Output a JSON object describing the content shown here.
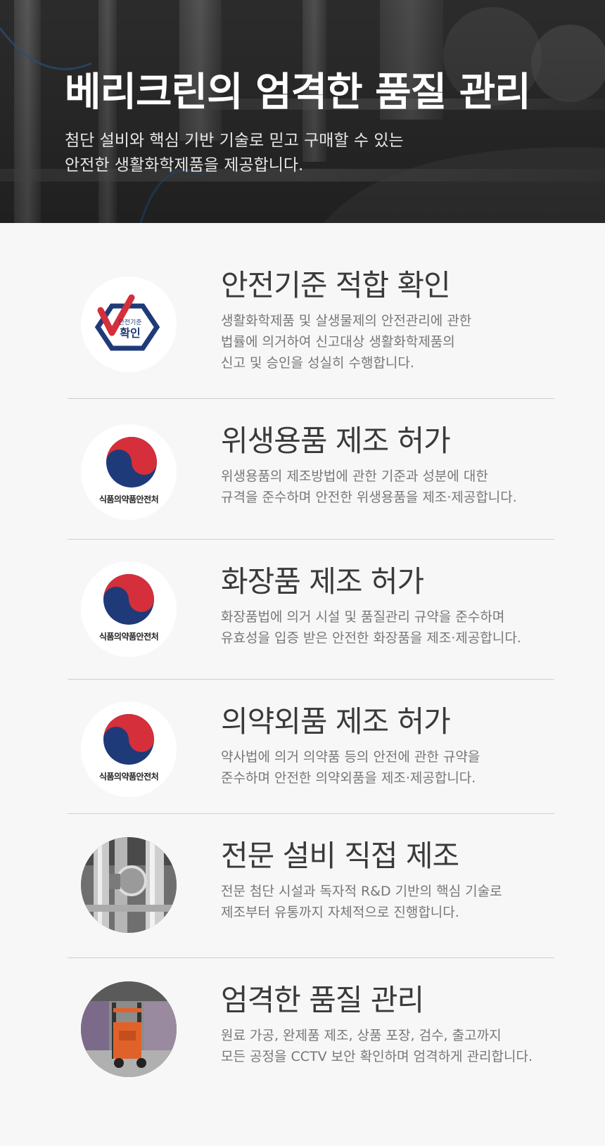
{
  "hero": {
    "title": "베리크린의 엄격한 품질 관리",
    "subtitle_line1": "첨단 설비와 핵심 기반 기술로 믿고 구매할 수 있는",
    "subtitle_line2": "안전한 생활화학제품을 제공합니다."
  },
  "items": [
    {
      "title": "안전기준 적합 확인",
      "desc": [
        "생활화학제품 및 살생물제의 안전관리에 관한",
        "법률에 의거하여 신고대상 생활화학제품의",
        "신고 및 승인을 성실히 수행합니다."
      ],
      "logo_text_small": "안전기준",
      "logo_text_big": "확인"
    },
    {
      "title": "위생용품 제조 허가",
      "desc": [
        "위생용품의 제조방법에 관한 기준과 성분에 대한",
        "규격을 준수하며 안전한 위생용품을 제조·제공합니다."
      ],
      "logo_label": "식품의약품안전처"
    },
    {
      "title": "화장품 제조 허가",
      "desc": [
        "화장품법에 의거 시설 및 품질관리 규약을 준수하며",
        "유효성을 입증 받은 안전한 화장품을 제조·제공합니다."
      ],
      "logo_label": "식품의약품안전처"
    },
    {
      "title": "의약외품 제조 허가",
      "desc": [
        "약사법에 의거 의약품 등의 안전에 관한 규약을",
        "준수하며 안전한 의약외품을 제조·제공합니다."
      ],
      "logo_label": "식품의약품안전처"
    },
    {
      "title": "전문 설비 직접 제조",
      "desc": [
        "전문 첨단 시설과 독자적 R&D 기반의 핵심 기술로",
        "제조부터 유통까지 자체적으로 진행합니다."
      ],
      "image": "stainless-equipment-photo"
    },
    {
      "title": "엄격한 품질 관리",
      "desc": [
        "원료 가공, 완제품 제조, 상품 포장, 검수, 출고까지",
        "모든 공정을 CCTV 보안 확인하며 엄격하게 관리합니다."
      ],
      "image": "forklift-warehouse-photo"
    }
  ],
  "colors": {
    "navy": "#1f3a78",
    "red": "#d42f3a",
    "divider": "#cfcfcf",
    "background": "#f7f7f7"
  }
}
